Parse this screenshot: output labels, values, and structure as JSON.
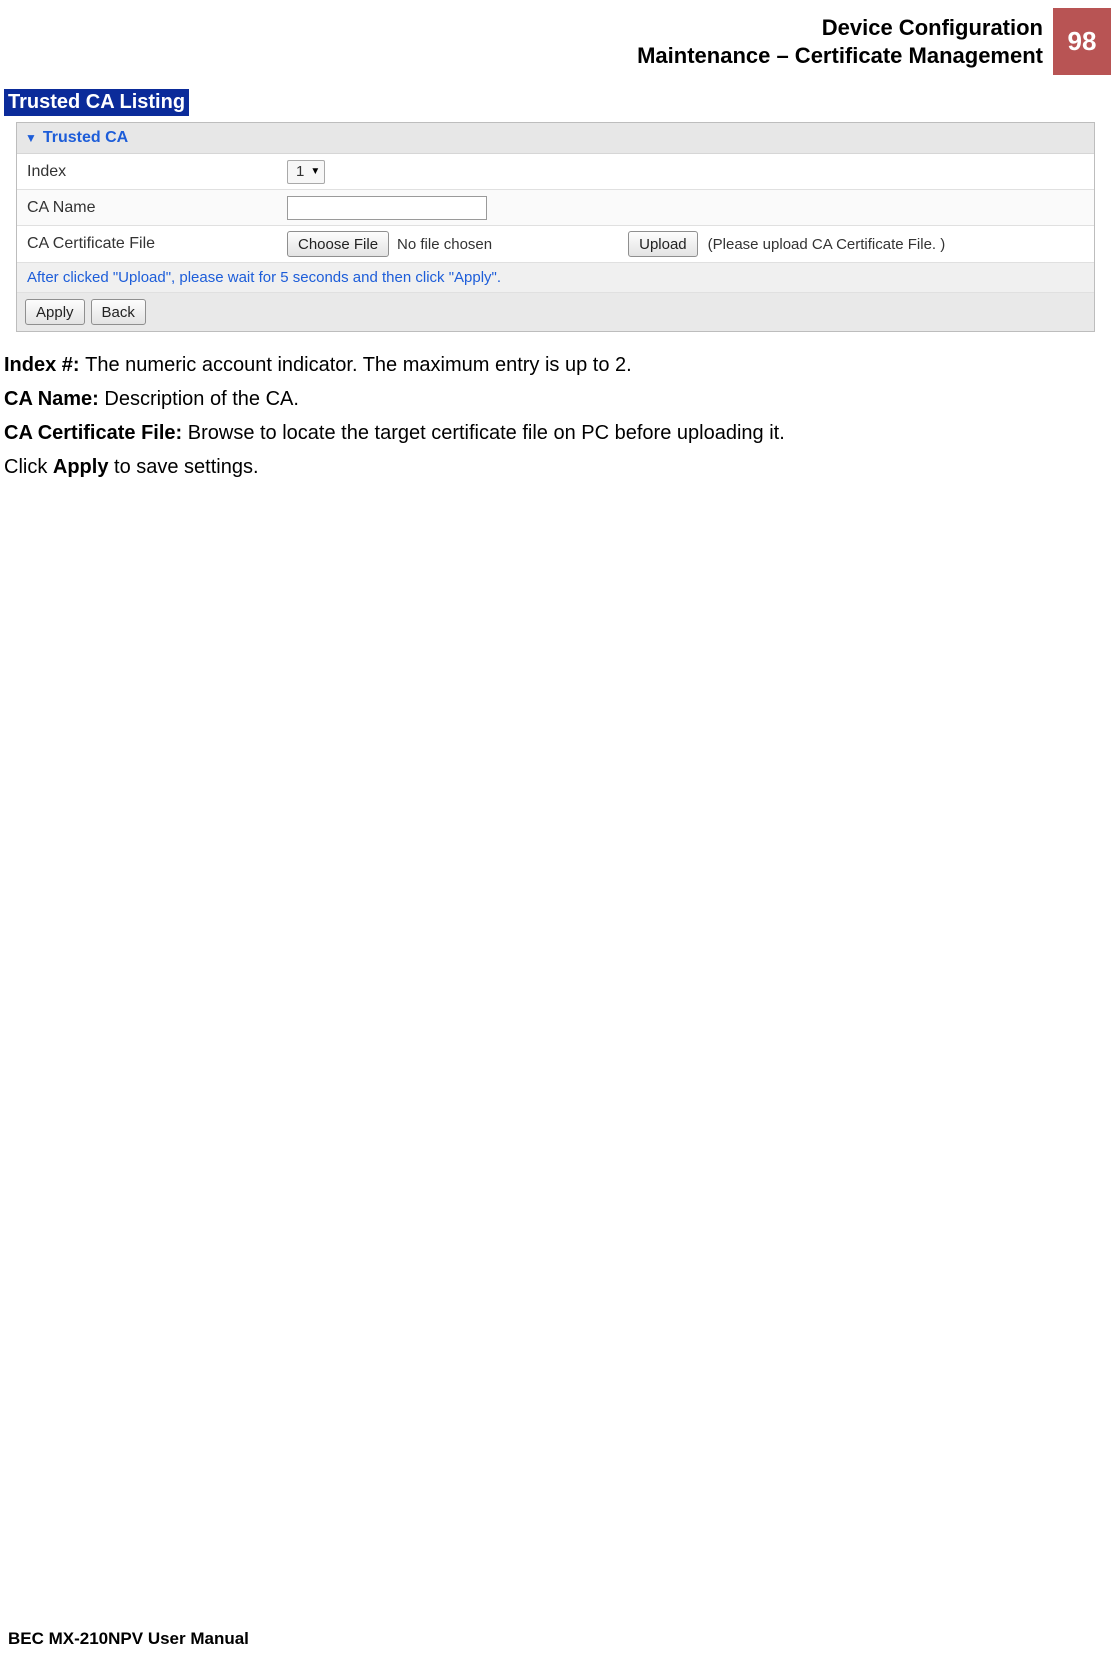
{
  "header": {
    "line1": "Device Configuration",
    "line2": "Maintenance – Certificate Management",
    "page_number": "98"
  },
  "section_title": "Trusted CA Listing",
  "panel": {
    "title": "Trusted CA",
    "rows": {
      "index": {
        "label": "Index",
        "selected": "1"
      },
      "ca_name": {
        "label": "CA Name",
        "value": ""
      },
      "ca_cert_file": {
        "label": "CA Certificate File",
        "choose_file_btn": "Choose File",
        "file_status": "No file chosen",
        "upload_btn": "Upload",
        "hint": "(Please upload CA Certificate File. )"
      }
    },
    "help_text": "After clicked \"Upload\", please wait for 5 seconds and then click \"Apply\".",
    "buttons": {
      "apply": "Apply",
      "back": "Back"
    }
  },
  "descriptions": {
    "index_label": "Index #: ",
    "index_text": "The numeric account indicator.  The maximum entry is up to 2.",
    "ca_name_label": "CA Name: ",
    "ca_name_text": "Description of the CA.",
    "ca_cert_label": "CA Certificate File: ",
    "ca_cert_text": "Browse to locate the target certificate file on PC before uploading it.",
    "apply_pre": "Click ",
    "apply_bold": "Apply",
    "apply_post": " to save settings."
  },
  "footer": "BEC MX-210NPV User Manual"
}
